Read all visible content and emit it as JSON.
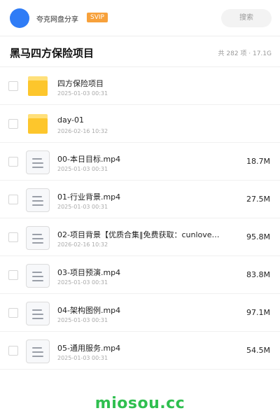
{
  "header": {
    "share_name": "夸克网盘分享",
    "badge": "SVIP",
    "search_label": "搜索"
  },
  "title_row": {
    "title": "黑马四方保险项目",
    "meta": "共 282 项 · 17.1G"
  },
  "items": [
    {
      "type": "folder",
      "name": "四方保险项目",
      "date": "2025-01-03 00:31",
      "size": ""
    },
    {
      "type": "folder",
      "name": "day-01",
      "date": "2026-02-16 10:32",
      "size": ""
    },
    {
      "type": "file",
      "name": "00-本日目标.mp4",
      "date": "2025-01-03 00:31",
      "size": "18.7M"
    },
    {
      "type": "file",
      "name": "01-行业背景.mp4",
      "date": "2025-01-03 00:31",
      "size": "27.5M"
    },
    {
      "type": "file",
      "name": "02-项目背景【优质合集‖免费获取：cunlove…",
      "date": "2026-02-16 10:32",
      "size": "95.8M"
    },
    {
      "type": "file",
      "name": "03-项目预演.mp4",
      "date": "2025-01-03 00:31",
      "size": "83.8M"
    },
    {
      "type": "file",
      "name": "04-架构图例.mp4",
      "date": "2025-01-03 00:31",
      "size": "97.1M"
    },
    {
      "type": "file",
      "name": "05-通用服务.mp4",
      "date": "2025-01-03 00:31",
      "size": "54.5M"
    }
  ],
  "watermark": "miosou.cc",
  "colors": {
    "avatar": "#2f7cf6",
    "svip": "#f7a13b",
    "folder": "#fdc62c",
    "watermark": "#2fbf4f"
  }
}
